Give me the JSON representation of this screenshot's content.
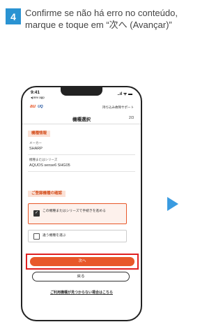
{
  "step": {
    "number": "4",
    "text": "Confirme se não há erro no conteúdo, marque e toque em “次へ (Avançar)”"
  },
  "phone": {
    "status": {
      "time": "9:41",
      "app": "◂prev app",
      "signal": "..ıl ᯤ ▬"
    },
    "header": {
      "logo": "au",
      "logo_sub": "UQ",
      "support": "持ち込み故障サポート"
    },
    "page": {
      "title": "機種選択",
      "count": "2/3"
    },
    "device_info": {
      "title": "機種情報",
      "maker_label": "メーカー",
      "maker_value": "SHARP",
      "series_label": "機種またはシリーズ",
      "series_value": "AQUOS sense6 SHG05"
    },
    "confirm": {
      "title": "ご登録機種の確認",
      "option1": "この機種またはシリーズで手続きを進める",
      "option2": "違う機種を選ぶ"
    },
    "buttons": {
      "next": "次へ",
      "back": "戻る"
    },
    "link": "ご利用機種が見つからない場合はこちら"
  },
  "colors": {
    "accent": "#e8582a",
    "badge": "#2a93d2",
    "highlight": "#e02020",
    "arrow": "#3a9be0"
  }
}
